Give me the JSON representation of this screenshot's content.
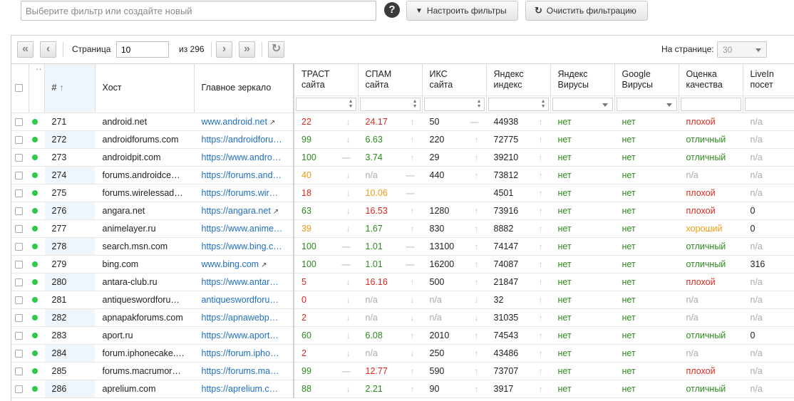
{
  "toolbar": {
    "filter_placeholder": "Выберите фильтр или создайте новый",
    "help": "?",
    "configure_label": "Настроить фильтры",
    "clear_label": "Очистить фильтрацию"
  },
  "pager": {
    "page_label": "Страница",
    "page_value": "10",
    "of_label": "из 296",
    "per_page_label": "На странице:",
    "per_page_value": "30"
  },
  "columns": {
    "num": "#",
    "host": "Хост",
    "mirror": "Главное зеркало",
    "trust_1": "ТРАСТ",
    "trust_2": "сайта",
    "spam_1": "СПАМ",
    "spam_2": "сайта",
    "iks_1": "ИКС",
    "iks_2": "сайта",
    "yindex_1": "Яндекс",
    "yindex_2": "индекс",
    "yvirus_1": "Яндекс",
    "yvirus_2": "Вирусы",
    "gvirus_1": "Google",
    "gvirus_2": "Вирусы",
    "quality_1": "Оценка",
    "quality_2": "качества",
    "lj_1": "LiveIn",
    "lj_2": "посет"
  },
  "colors": {
    "red": "#e0271e",
    "green": "#2d8a1d",
    "orange": "#f09a12",
    "link": "#1f6fbf",
    "status_dot": "#2ec84a"
  },
  "rows": [
    {
      "num": "271",
      "host": "android.net",
      "mirror": "www.android.net",
      "mirror_ext": true,
      "trust": "22",
      "trust_c": "red",
      "trust_t": "↓",
      "spam": "24.17",
      "spam_c": "red",
      "spam_t": "↑",
      "iks": "50",
      "iks_t": "—",
      "yidx": "44938",
      "yidx_t": "↑",
      "yv": "нет",
      "gv": "нет",
      "q": "плохой",
      "q_c": "red",
      "lj": "n/a",
      "lj_c": "gray"
    },
    {
      "num": "272",
      "host": "androidforums.com",
      "mirror": "https://androidforu…",
      "mirror_ext": false,
      "trust": "99",
      "trust_c": "green",
      "trust_t": "↓",
      "spam": "6.63",
      "spam_c": "green",
      "spam_t": "↑",
      "iks": "220",
      "iks_t": "↑",
      "yidx": "72775",
      "yidx_t": "↑",
      "yv": "нет",
      "gv": "нет",
      "q": "отличный",
      "q_c": "green",
      "lj": "n/a",
      "lj_c": "gray"
    },
    {
      "num": "273",
      "host": "androidpit.com",
      "mirror": "https://www.andro…",
      "mirror_ext": false,
      "trust": "100",
      "trust_c": "green",
      "trust_t": "—",
      "spam": "3.74",
      "spam_c": "green",
      "spam_t": "↑",
      "iks": "29",
      "iks_t": "↑",
      "yidx": "39210",
      "yidx_t": "↑",
      "yv": "нет",
      "gv": "нет",
      "q": "отличный",
      "q_c": "green",
      "lj": "n/a",
      "lj_c": "gray"
    },
    {
      "num": "274",
      "host": "forums.androidce…",
      "mirror": "https://forums.and…",
      "mirror_ext": false,
      "trust": "40",
      "trust_c": "orange",
      "trust_t": "↓",
      "spam": "n/a",
      "spam_c": "gray",
      "spam_t": "—",
      "iks": "440",
      "iks_t": "↑",
      "yidx": "73812",
      "yidx_t": "↑",
      "yv": "нет",
      "gv": "нет",
      "q": "n/a",
      "q_c": "gray",
      "lj": "n/a",
      "lj_c": "gray"
    },
    {
      "num": "275",
      "host": "forums.wirelessad…",
      "mirror": "https://forums.wir…",
      "mirror_ext": false,
      "trust": "18",
      "trust_c": "red",
      "trust_t": "↓",
      "spam": "10.06",
      "spam_c": "orange",
      "spam_t": "—",
      "iks": "",
      "iks_t": "",
      "yidx": "4501",
      "yidx_t": "↑",
      "yv": "нет",
      "gv": "нет",
      "q": "плохой",
      "q_c": "red",
      "lj": "n/a",
      "lj_c": "gray"
    },
    {
      "num": "276",
      "host": "angara.net",
      "mirror": "https://angara.net",
      "mirror_ext": true,
      "trust": "63",
      "trust_c": "green",
      "trust_t": "↓",
      "spam": "16.53",
      "spam_c": "red",
      "spam_t": "↑",
      "iks": "1280",
      "iks_t": "↑",
      "yidx": "73916",
      "yidx_t": "↑",
      "yv": "нет",
      "gv": "нет",
      "q": "плохой",
      "q_c": "red",
      "lj": "0",
      "lj_c": "black"
    },
    {
      "num": "277",
      "host": "animelayer.ru",
      "mirror": "https://www.anime…",
      "mirror_ext": false,
      "trust": "39",
      "trust_c": "orange",
      "trust_t": "↓",
      "spam": "1.67",
      "spam_c": "green",
      "spam_t": "↑",
      "iks": "830",
      "iks_t": "↑",
      "yidx": "8882",
      "yidx_t": "↑",
      "yv": "нет",
      "gv": "нет",
      "q": "хороший",
      "q_c": "orange",
      "lj": "0",
      "lj_c": "black"
    },
    {
      "num": "278",
      "host": "search.msn.com",
      "mirror": "https://www.bing.c…",
      "mirror_ext": false,
      "trust": "100",
      "trust_c": "green",
      "trust_t": "—",
      "spam": "1.01",
      "spam_c": "green",
      "spam_t": "—",
      "iks": "13100",
      "iks_t": "↑",
      "yidx": "74147",
      "yidx_t": "↑",
      "yv": "нет",
      "gv": "нет",
      "q": "отличный",
      "q_c": "green",
      "lj": "n/a",
      "lj_c": "gray"
    },
    {
      "num": "279",
      "host": "bing.com",
      "mirror": "www.bing.com",
      "mirror_ext": true,
      "trust": "100",
      "trust_c": "green",
      "trust_t": "—",
      "spam": "1.01",
      "spam_c": "green",
      "spam_t": "—",
      "iks": "16200",
      "iks_t": "↑",
      "yidx": "74087",
      "yidx_t": "↑",
      "yv": "нет",
      "gv": "нет",
      "q": "отличный",
      "q_c": "green",
      "lj": "316",
      "lj_c": "black"
    },
    {
      "num": "280",
      "host": "antara-club.ru",
      "mirror": "https://www.antar…",
      "mirror_ext": false,
      "trust": "5",
      "trust_c": "red",
      "trust_t": "↓",
      "spam": "16.16",
      "spam_c": "red",
      "spam_t": "↑",
      "iks": "500",
      "iks_t": "↑",
      "yidx": "21847",
      "yidx_t": "↑",
      "yv": "нет",
      "gv": "нет",
      "q": "плохой",
      "q_c": "red",
      "lj": "n/a",
      "lj_c": "gray"
    },
    {
      "num": "281",
      "host": "antiqueswordforu…",
      "mirror": "antiqueswordforu…",
      "mirror_ext": false,
      "trust": "0",
      "trust_c": "red",
      "trust_t": "↓",
      "spam": "n/a",
      "spam_c": "gray",
      "spam_t": "↓",
      "iks": "n/a",
      "iks_c": "gray",
      "iks_t": "↓",
      "yidx": "32",
      "yidx_t": "↑",
      "yv": "нет",
      "gv": "нет",
      "q": "n/a",
      "q_c": "gray",
      "lj": "n/a",
      "lj_c": "gray"
    },
    {
      "num": "282",
      "host": "apnapakforums.com",
      "mirror": "https://apnawebp…",
      "mirror_ext": false,
      "trust": "2",
      "trust_c": "red",
      "trust_t": "↓",
      "spam": "n/a",
      "spam_c": "gray",
      "spam_t": "↓",
      "iks": "n/a",
      "iks_c": "gray",
      "iks_t": "↓",
      "yidx": "31035",
      "yidx_t": "↑",
      "yv": "нет",
      "gv": "нет",
      "q": "n/a",
      "q_c": "gray",
      "lj": "n/a",
      "lj_c": "gray"
    },
    {
      "num": "283",
      "host": "aport.ru",
      "mirror": "https://www.aport…",
      "mirror_ext": false,
      "trust": "60",
      "trust_c": "green",
      "trust_t": "↓",
      "spam": "6.08",
      "spam_c": "green",
      "spam_t": "↑",
      "iks": "2010",
      "iks_t": "↑",
      "yidx": "74543",
      "yidx_t": "↑",
      "yv": "нет",
      "gv": "нет",
      "q": "отличный",
      "q_c": "green",
      "lj": "0",
      "lj_c": "black"
    },
    {
      "num": "284",
      "host": "forum.iphonecake.…",
      "mirror": "https://forum.ipho…",
      "mirror_ext": false,
      "trust": "2",
      "trust_c": "red",
      "trust_t": "↓",
      "spam": "n/a",
      "spam_c": "gray",
      "spam_t": "↓",
      "iks": "250",
      "iks_t": "↑",
      "yidx": "43486",
      "yidx_t": "↑",
      "yv": "нет",
      "gv": "нет",
      "q": "n/a",
      "q_c": "gray",
      "lj": "n/a",
      "lj_c": "gray"
    },
    {
      "num": "285",
      "host": "forums.macrumor…",
      "mirror": "https://forums.ma…",
      "mirror_ext": false,
      "trust": "99",
      "trust_c": "green",
      "trust_t": "—",
      "spam": "12.77",
      "spam_c": "red",
      "spam_t": "↑",
      "iks": "590",
      "iks_t": "↑",
      "yidx": "73707",
      "yidx_t": "↑",
      "yv": "нет",
      "gv": "нет",
      "q": "плохой",
      "q_c": "red",
      "lj": "n/a",
      "lj_c": "gray"
    },
    {
      "num": "286",
      "host": "aprelium.com",
      "mirror": "https://aprelium.c…",
      "mirror_ext": false,
      "trust": "88",
      "trust_c": "green",
      "trust_t": "↓",
      "spam": "2.21",
      "spam_c": "green",
      "spam_t": "↑",
      "iks": "90",
      "iks_t": "↑",
      "yidx": "3917",
      "yidx_t": "↑",
      "yv": "нет",
      "gv": "нет",
      "q": "отличный",
      "q_c": "green",
      "lj": "n/a",
      "lj_c": "gray"
    }
  ]
}
